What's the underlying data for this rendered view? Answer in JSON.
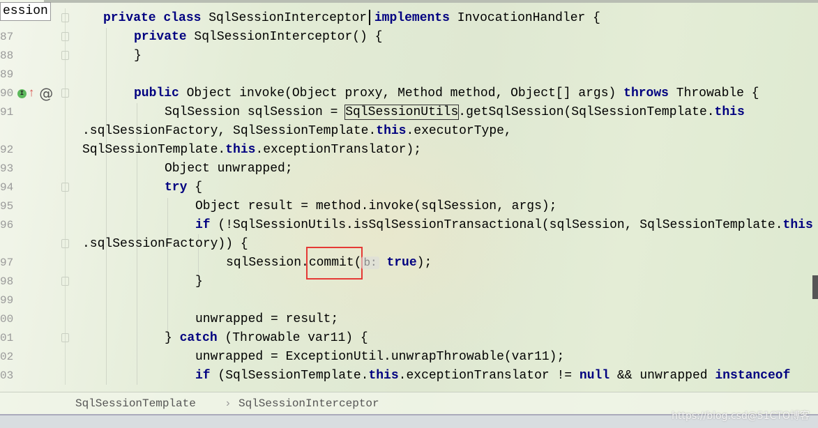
{
  "tooltip": "ession",
  "gutter_icons": {
    "implements_badge": "I",
    "override_arrow": "↑",
    "annotation": "@"
  },
  "lines": [
    {
      "num": "",
      "indent": 148,
      "tokens": [
        [
          "private class ",
          "kw"
        ],
        [
          "SqlSessionInterceptor",
          ""
        ],
        [
          " implements ",
          "kw"
        ],
        [
          "InvocationHandler {",
          ""
        ]
      ]
    },
    {
      "num": "87",
      "indent": 192,
      "tokens": [
        [
          "private ",
          "kw"
        ],
        [
          "SqlSessionInterceptor() {",
          ""
        ]
      ]
    },
    {
      "num": "88",
      "indent": 192,
      "tokens": [
        [
          "}",
          ""
        ]
      ]
    },
    {
      "num": "89",
      "indent": 192,
      "tokens": []
    },
    {
      "num": "90",
      "indent": 192,
      "tokens": [
        [
          "public ",
          "kw"
        ],
        [
          "Object invoke(Object proxy, Method method, Object[] args) ",
          ""
        ],
        [
          "throws ",
          "kw"
        ],
        [
          "Throwable {",
          ""
        ]
      ]
    },
    {
      "num": "91",
      "indent": 236,
      "tokens": [
        [
          "SqlSession sqlSession = ",
          ""
        ],
        [
          "SqlSessionUtils",
          "boxed"
        ],
        [
          ".getSqlSession(SqlSessionTemplate.",
          ""
        ],
        [
          "this",
          "kw"
        ]
      ]
    },
    {
      "num": "",
      "indent": 118,
      "tokens": [
        [
          ".sqlSessionFactory, SqlSessionTemplate.",
          ""
        ],
        [
          "this",
          "kw"
        ],
        [
          ".executorType, SqlSessionTemplate.",
          ""
        ],
        [
          "this",
          "kw"
        ],
        [
          ".exceptionTranslator);",
          ""
        ]
      ]
    },
    {
      "num": "92",
      "indent": 236,
      "tokens": []
    },
    {
      "num": "93",
      "indent": 236,
      "tokens": [
        [
          "Object unwrapped;",
          ""
        ]
      ]
    },
    {
      "num": "94",
      "indent": 236,
      "tokens": [
        [
          "try ",
          "kw"
        ],
        [
          "{",
          ""
        ]
      ]
    },
    {
      "num": "95",
      "indent": 280,
      "tokens": [
        [
          "Object result = method.invoke(sqlSession, args);",
          ""
        ]
      ]
    },
    {
      "num": "96",
      "indent": 280,
      "tokens": [
        [
          "if ",
          "kw"
        ],
        [
          "(!SqlSessionUtils.isSqlSessionTransactional(sqlSession, SqlSessionTemplate.",
          ""
        ],
        [
          "this",
          "kw"
        ]
      ]
    },
    {
      "num": "",
      "indent": 118,
      "tokens": [
        [
          ".sqlSessionFactory)) {",
          ""
        ]
      ]
    },
    {
      "num": "97",
      "indent": 324,
      "tokens": [
        [
          "sqlSession.commit(",
          ""
        ],
        [
          "b:",
          "hint"
        ],
        [
          " ",
          ""
        ],
        [
          "true",
          "kw"
        ],
        [
          ");",
          ""
        ]
      ]
    },
    {
      "num": "98",
      "indent": 280,
      "tokens": [
        [
          "}",
          ""
        ]
      ]
    },
    {
      "num": "99",
      "indent": 280,
      "tokens": []
    },
    {
      "num": "00",
      "indent": 280,
      "tokens": [
        [
          "unwrapped = result;",
          ""
        ]
      ]
    },
    {
      "num": "01",
      "indent": 236,
      "tokens": [
        [
          "} ",
          ""
        ],
        [
          "catch ",
          "kw"
        ],
        [
          "(Throwable var11) {",
          ""
        ]
      ]
    },
    {
      "num": "02",
      "indent": 280,
      "tokens": [
        [
          "unwrapped = ExceptionUtil.unwrapThrowable(var11);",
          ""
        ]
      ]
    },
    {
      "num": "03",
      "indent": 280,
      "tokens": [
        [
          "if ",
          "kw"
        ],
        [
          "(SqlSessionTemplate.",
          ""
        ],
        [
          "this",
          "kw"
        ],
        [
          ".exceptionTranslator != ",
          ""
        ],
        [
          "null ",
          "kw"
        ],
        [
          "&& unwrapped ",
          ""
        ],
        [
          "instanceof",
          "kw"
        ]
      ]
    }
  ],
  "breadcrumb": [
    "SqlSessionTemplate",
    "SqlSessionInterceptor"
  ],
  "breadcrumb_separator": "›",
  "watermark": "https://blog.csd@51CTO博客",
  "colors": {
    "keyword": "#000080",
    "highlight_box": "#e53935"
  }
}
